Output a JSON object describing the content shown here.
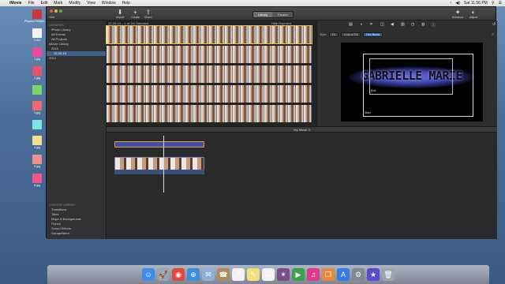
{
  "menubar": {
    "app": "iMovie",
    "items": [
      "File",
      "Edit",
      "Mark",
      "Modify",
      "View",
      "Window",
      "Help"
    ],
    "clock": "Sat 11:56 PM"
  },
  "desktop_icons": [
    {
      "label": "Physics Rehabi...rpt",
      "color": "#c83a3a"
    },
    {
      "label": "2.doc",
      "color": "#f2f2f2"
    },
    {
      "label": "1.jpg",
      "color": "#ef4a9a"
    },
    {
      "label": "2.jpg",
      "color": "#e0566e"
    },
    {
      "label": "",
      "color": "#7ed46a"
    },
    {
      "label": "3.jpg",
      "color": "#ef6a6a"
    },
    {
      "label": "",
      "color": "#7ee4e4"
    },
    {
      "label": "4.jpg",
      "color": "#f2e08a"
    },
    {
      "label": "5.jpg",
      "color": "#ee9090"
    },
    {
      "label": "6.jpg",
      "color": "#ef5a8a"
    }
  ],
  "toolbar": {
    "hide_label": "Hide",
    "import": "Import",
    "create": "Create",
    "share": "Share",
    "library_tab": "Library",
    "theater_tab": "Theater",
    "enhance": "Enhance",
    "adjust": "Adjust"
  },
  "sidebar": {
    "header": "LIBRARIES",
    "items": [
      {
        "label": "iPhoto Library",
        "indent": 6,
        "selected": false
      },
      {
        "label": "All Events",
        "indent": 6,
        "selected": false
      },
      {
        "label": "All Projects",
        "indent": 6,
        "selected": false
      },
      {
        "label": "iMovie Library",
        "indent": 3,
        "selected": false
      },
      {
        "label": "2015",
        "indent": 6,
        "selected": false
      },
      {
        "label": "12-20-14",
        "indent": 9,
        "selected": true
      },
      {
        "label": "2014",
        "indent": 3,
        "selected": false
      }
    ],
    "content_header": "CONTENT LIBRARY",
    "content_items": [
      "Transitions",
      "Titles",
      "Maps & Backgrounds",
      "iTunes",
      "Sound Effects",
      "GarageBand"
    ]
  },
  "browser": {
    "event_label": "12-20-14 – 1 of 111 Selected",
    "filter_label": "Hide Rejected"
  },
  "viewer": {
    "style_label": "Style:",
    "style_options": [
      "Fit",
      "Crop to Fill",
      "Ken Burns"
    ],
    "selected_style": "Ken Burns",
    "title_text": "GABRIELLE MARIE",
    "start_label": "Start",
    "end_label": "End"
  },
  "timeline": {
    "project_name": "My Movie 3"
  }
}
